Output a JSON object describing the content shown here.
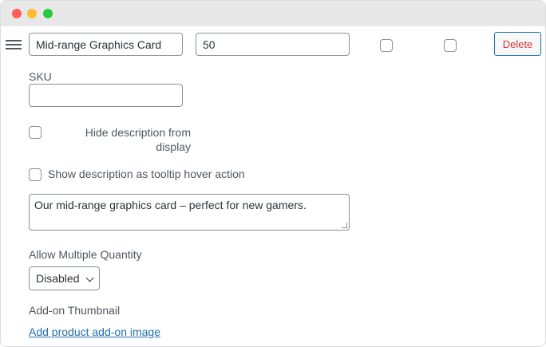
{
  "addon": {
    "name_value": "Mid-range Graphics Card",
    "price_value": "50",
    "delete_label": "Delete",
    "sku_label": "SKU",
    "sku_value": "",
    "hide_description_label": "Hide description from display",
    "tooltip_label": "Show description as tooltip hover action",
    "description_value": "Our mid-range graphics card – perfect for new gamers.",
    "allow_multiple_quantity_label": "Allow Multiple Quantity",
    "quantity_selected": "Disabled",
    "thumbnail_label": "Add-on Thumbnail",
    "add_image_link": "Add product add-on image"
  },
  "icons": {
    "drag": "hamburger-drag-icon",
    "select": "chevron-down-icon"
  },
  "colors": {
    "link": "#2271b1",
    "delete": "#d63638",
    "border": "#8c8f94"
  }
}
